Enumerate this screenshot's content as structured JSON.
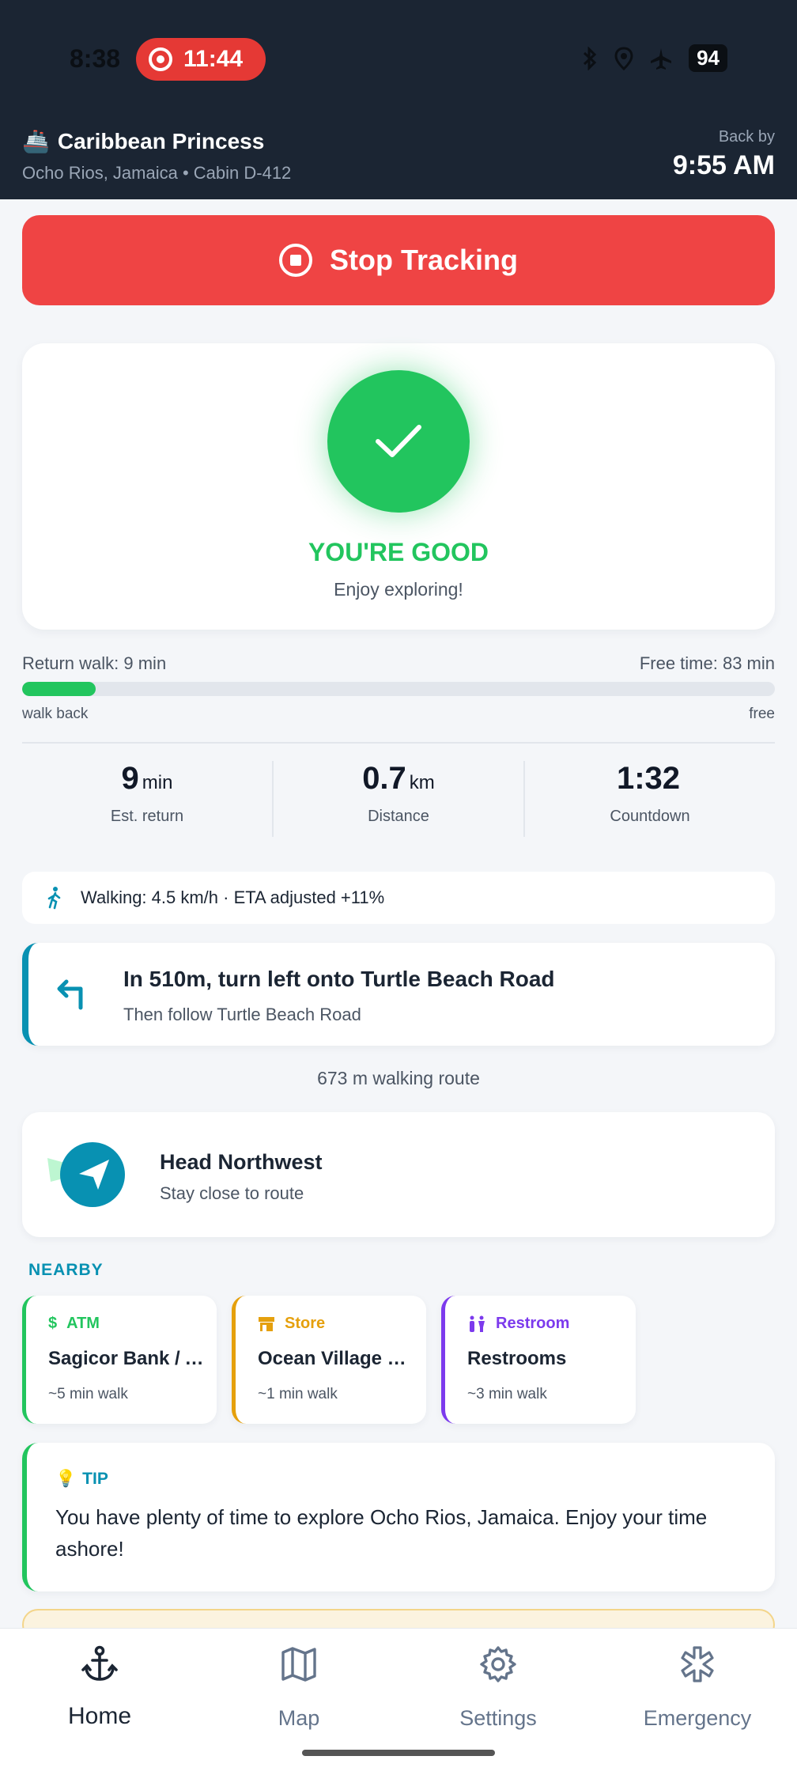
{
  "status_bar": {
    "clock": "8:38",
    "recording_timer": "11:44",
    "battery": "94",
    "icons": [
      "bluetooth-icon",
      "location-icon",
      "airplane-icon"
    ]
  },
  "header": {
    "ship_emoji": "🚢",
    "ship_name": "Caribbean Princess",
    "subtitle": "Ocho Rios, Jamaica • Cabin D-412",
    "back_by_label": "Back by",
    "back_by_time": "9:55 AM"
  },
  "stop_button": {
    "label": "Stop Tracking",
    "color": "#ef4444"
  },
  "status": {
    "title": "YOU'RE GOOD",
    "subtitle": "Enjoy exploring!",
    "color": "#22c55e"
  },
  "progress": {
    "return_walk": "Return walk: 9 min",
    "free_time": "Free time: 83 min",
    "walk_label": "walk back",
    "free_label": "free",
    "walk_fraction": 0.098
  },
  "stats": [
    {
      "value": "9",
      "unit": "min",
      "label": "Est. return"
    },
    {
      "value": "0.7",
      "unit": "km",
      "label": "Distance"
    },
    {
      "value": "1:32",
      "unit": "",
      "label": "Countdown"
    }
  ],
  "walking": {
    "text": "Walking: 4.5 km/h · ETA adjusted +11%"
  },
  "turn": {
    "main": "In 510m, turn left onto Turtle Beach Road",
    "sub": "Then follow Turtle Beach Road"
  },
  "route_length": "673 m walking route",
  "heading": {
    "title": "Head Northwest",
    "subtitle": "Stay close to route"
  },
  "nearby": {
    "title": "NEARBY",
    "items": [
      {
        "icon": "$",
        "category": "ATM",
        "name": "Sagicor Bank / ATM",
        "distance": "~5 min walk",
        "color": "#22c55e"
      },
      {
        "icon": "store-icon",
        "category": "Store",
        "name": "Ocean Village Shopping",
        "distance": "~1 min walk",
        "color": "#e5a00d"
      },
      {
        "icon": "restroom-icon",
        "category": "Restroom",
        "name": "Restrooms",
        "distance": "~3 min walk",
        "color": "#7c3aed"
      }
    ]
  },
  "tip": {
    "icon": "💡",
    "label": "TIP",
    "text": "You have plenty of time to explore Ocho Rios, Jamaica. Enjoy your time ashore!"
  },
  "nav": {
    "items": [
      {
        "label": "Home",
        "icon": "anchor-icon",
        "active": true
      },
      {
        "label": "Map",
        "icon": "map-icon",
        "active": false
      },
      {
        "label": "Settings",
        "icon": "gear-icon",
        "active": false
      },
      {
        "label": "Emergency",
        "icon": "medical-star-icon",
        "active": false
      }
    ]
  }
}
